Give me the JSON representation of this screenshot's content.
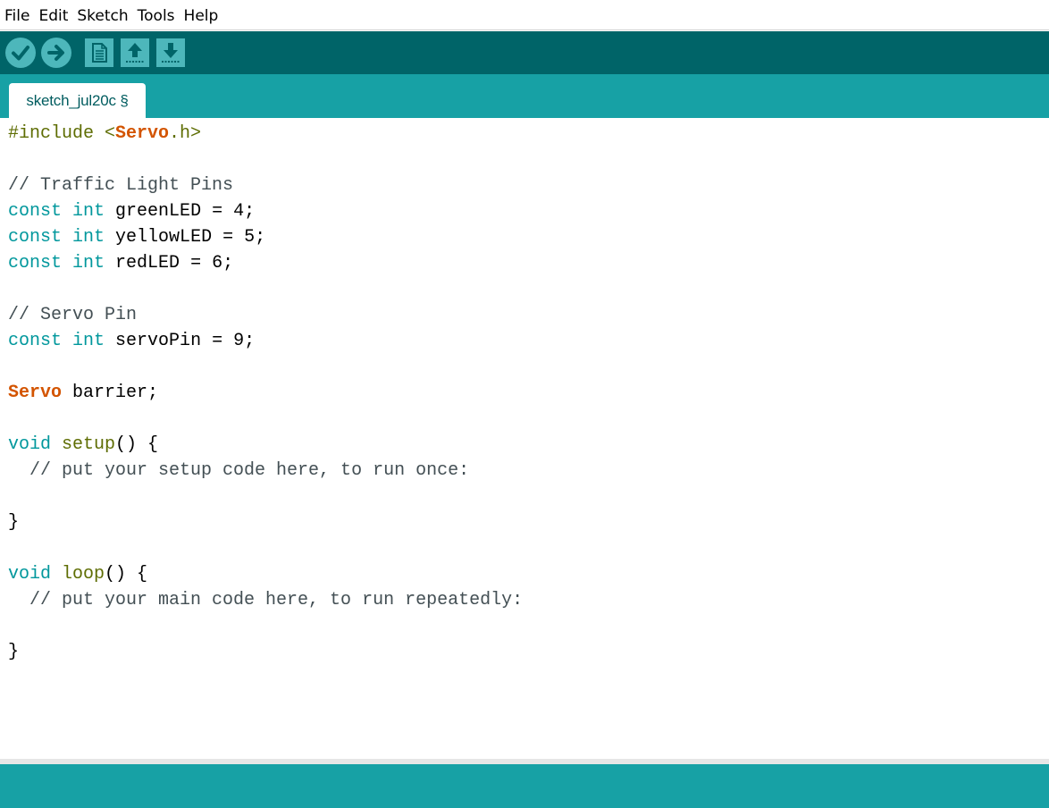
{
  "menu": {
    "file": "File",
    "edit": "Edit",
    "sketch": "Sketch",
    "tools": "Tools",
    "help": "Help"
  },
  "toolbar": {
    "buttons": [
      "verify-icon",
      "upload-icon",
      "new-icon",
      "open-icon",
      "save-icon"
    ]
  },
  "tab": {
    "label": "sketch_jul20c §"
  },
  "code": [
    [
      {
        "t": "#include <",
        "c": "pre"
      },
      {
        "t": "Servo",
        "c": "cls"
      },
      {
        "t": ".h>",
        "c": "pre"
      }
    ],
    [],
    [
      {
        "t": "// Traffic Light Pins",
        "c": "cmt"
      }
    ],
    [
      {
        "t": "const",
        "c": "type"
      },
      {
        "t": " "
      },
      {
        "t": "int",
        "c": "type"
      },
      {
        "t": " greenLED = 4;"
      }
    ],
    [
      {
        "t": "const",
        "c": "type"
      },
      {
        "t": " "
      },
      {
        "t": "int",
        "c": "type"
      },
      {
        "t": " yellowLED = 5;"
      }
    ],
    [
      {
        "t": "const",
        "c": "type"
      },
      {
        "t": " "
      },
      {
        "t": "int",
        "c": "type"
      },
      {
        "t": " redLED = 6;"
      }
    ],
    [],
    [
      {
        "t": "// Servo Pin",
        "c": "cmt"
      }
    ],
    [
      {
        "t": "const",
        "c": "type"
      },
      {
        "t": " "
      },
      {
        "t": "int",
        "c": "type"
      },
      {
        "t": " servoPin = 9;"
      }
    ],
    [],
    [
      {
        "t": "Servo",
        "c": "cls"
      },
      {
        "t": " barrier;"
      }
    ],
    [],
    [
      {
        "t": "void",
        "c": "type"
      },
      {
        "t": " "
      },
      {
        "t": "setup",
        "c": "fn"
      },
      {
        "t": "() {"
      }
    ],
    [
      {
        "t": "  // put your setup code here, to run once:",
        "c": "cmt"
      }
    ],
    [],
    [
      {
        "t": "}"
      }
    ],
    [],
    [
      {
        "t": "void",
        "c": "type"
      },
      {
        "t": " "
      },
      {
        "t": "loop",
        "c": "fn"
      },
      {
        "t": "() {"
      }
    ],
    [
      {
        "t": "  // put your main code here, to run repeatedly:",
        "c": "cmt"
      }
    ],
    [],
    [
      {
        "t": "}"
      }
    ]
  ],
  "colors": {
    "toolbar_bg": "#006468",
    "tab_strip_bg": "#17a1a5",
    "button_bg": "#4db7bb",
    "keyword": "#00979c",
    "class": "#d35400",
    "preprocessor": "#5e6d03",
    "comment": "#434f54"
  }
}
